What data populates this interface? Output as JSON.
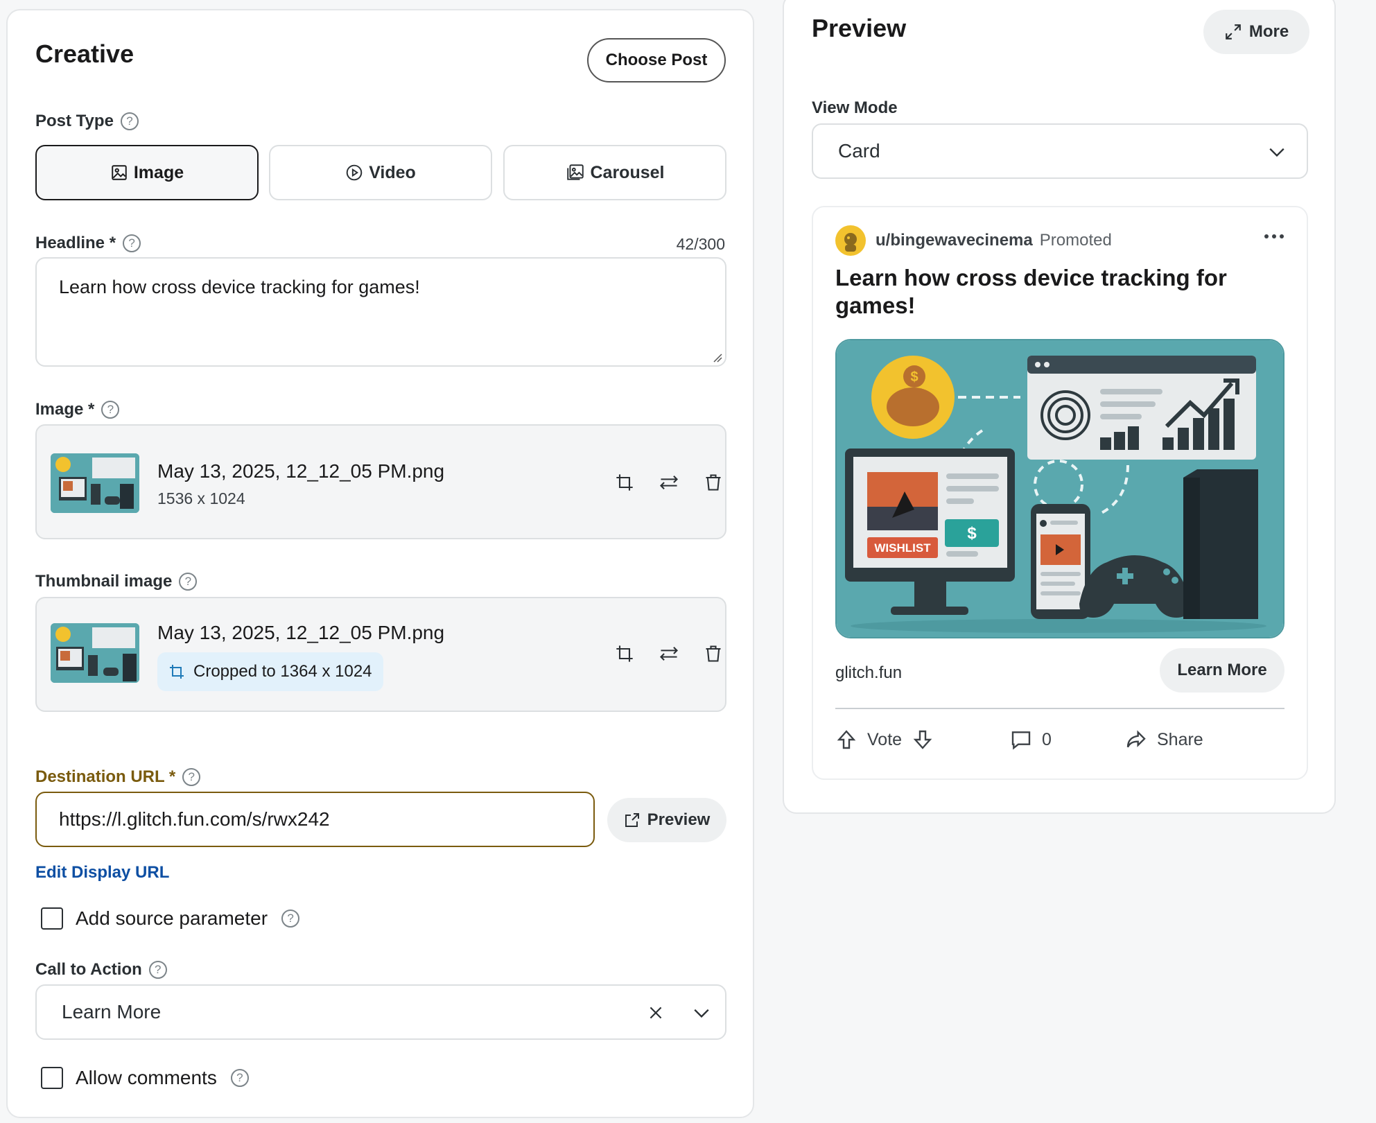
{
  "creative": {
    "title": "Creative",
    "choose_post": "Choose Post",
    "post_type_label": "Post Type",
    "post_types": [
      "Image",
      "Video",
      "Carousel"
    ],
    "headline_label": "Headline *",
    "headline_count": "42/300",
    "headline_value": "Learn how cross device tracking for games!",
    "image_label": "Image *",
    "image_file": {
      "name": "May 13, 2025, 12_12_05 PM.png",
      "dims": "1536 x 1024"
    },
    "thumbnail_label": "Thumbnail image",
    "thumbnail_file": {
      "name": "May 13, 2025, 12_12_05 PM.png",
      "crop": "Cropped to 1364 x 1024"
    },
    "destination_label": "Destination URL *",
    "destination_value": "https://l.glitch.fun.com/s/rwx242",
    "preview_button": "Preview",
    "edit_display_url": "Edit Display URL",
    "add_source_param": "Add source parameter",
    "cta_label": "Call to Action",
    "cta_value": "Learn More",
    "allow_comments": "Allow comments"
  },
  "preview": {
    "title": "Preview",
    "more_button": "More",
    "view_mode_label": "View Mode",
    "view_mode_value": "Card",
    "card": {
      "username": "u/bingewavecinema",
      "promoted": "Promoted",
      "headline": "Learn how cross device tracking for games!",
      "domain": "glitch.fun",
      "cta": "Learn More",
      "vote_label": "Vote",
      "comments": "0",
      "share_label": "Share",
      "image_badge": "WISHLIST",
      "image_dollar": "$"
    }
  },
  "colors": {
    "accent_gold": "#7a5b0e",
    "link_blue": "#0e4fa3",
    "illustration_bg": "#5aa8ae"
  }
}
